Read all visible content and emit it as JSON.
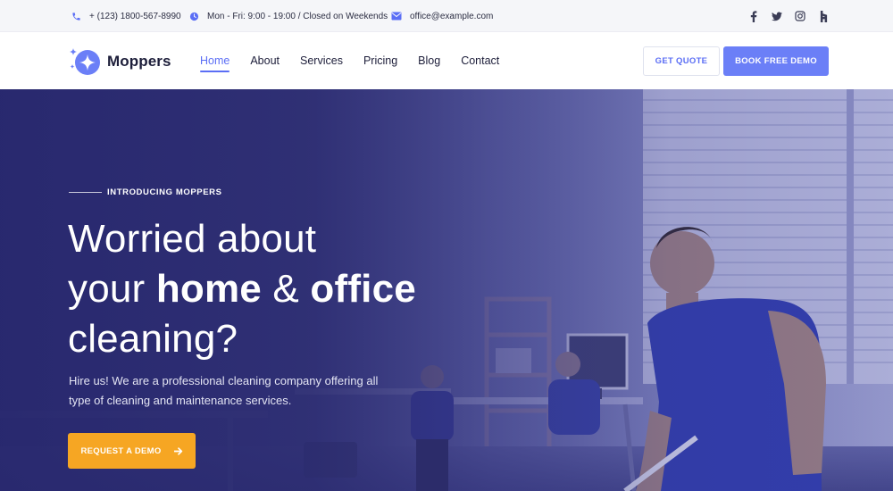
{
  "topbar": {
    "phone": "+ (123) 1800-567-8990",
    "hours": "Mon - Fri: 9:00 - 19:00 / Closed on Weekends",
    "email": "office@example.com",
    "socials": [
      "facebook-icon",
      "twitter-icon",
      "instagram-icon",
      "houzz-icon"
    ]
  },
  "header": {
    "logo": "Moppers",
    "nav": [
      "Home",
      "About",
      "Services",
      "Pricing",
      "Blog",
      "Contact"
    ],
    "active_nav": "Home",
    "get_quote": "GET QUOTE",
    "book_demo": "BOOK FREE DEMO"
  },
  "hero": {
    "eyebrow": "INTRODUCING MOPPERS",
    "headline": {
      "line1": "Worried about",
      "line2_pre": "your ",
      "line2_bold1": "home",
      "line2_mid": " & ",
      "line2_bold2": "office",
      "line3": "cleaning?"
    },
    "subtext": "Hire us! We are a professional cleaning company offering all type of cleaning and maintenance services.",
    "cta": "REQUEST A DEMO"
  },
  "colors": {
    "accent": "#5b6ef5",
    "cta": "#f6a623",
    "hero_overlay": "#2b2b70"
  }
}
